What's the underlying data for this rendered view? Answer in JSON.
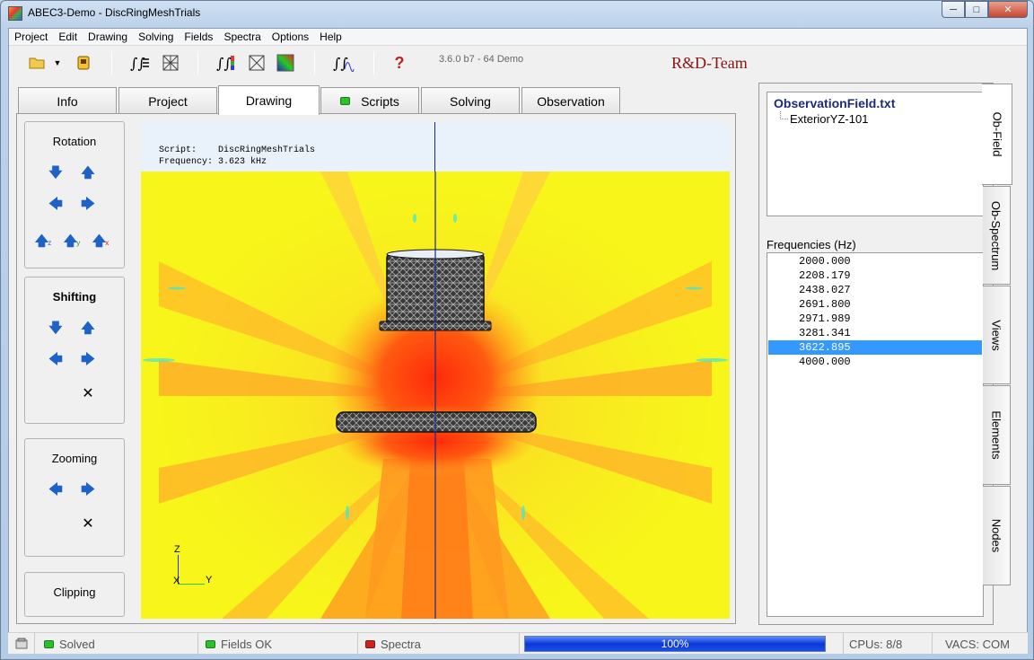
{
  "window": {
    "title": "ABEC3-Demo - DiscRingMeshTrials"
  },
  "menu": [
    "Project",
    "Edit",
    "Drawing",
    "Solving",
    "Fields",
    "Spectra",
    "Options",
    "Help"
  ],
  "toolbar": {
    "version": "3.6.0 b7 - 64 Demo",
    "team": "R&D-Team",
    "help_glyph": "?"
  },
  "tabs": [
    "Info",
    "Project",
    "Drawing",
    "Scripts",
    "Solving",
    "Observation"
  ],
  "active_tab": "Drawing",
  "controls": {
    "rotation": {
      "title": "Rotation",
      "axes": [
        "z",
        "y",
        "x"
      ]
    },
    "shifting": {
      "title": "Shifting"
    },
    "zooming": {
      "title": "Zooming"
    },
    "clipping": {
      "title": "Clipping"
    }
  },
  "viewport": {
    "script_label": "Script:",
    "script_value": "DiscRingMeshTrials",
    "frequency_label": "Frequency:",
    "frequency_value": "3.623 kHz",
    "axis_z": "Z",
    "axis_x": "X",
    "axis_y": "Y"
  },
  "observation": {
    "file": "ObservationField.txt",
    "child": "ExteriorYZ-101",
    "frequencies_label": "Frequencies  (Hz)",
    "frequencies": [
      "2000.000",
      "2208.179",
      "2438.027",
      "2691.800",
      "2971.989",
      "3281.341",
      "3622.895",
      "4000.000"
    ],
    "selected_index": 6
  },
  "vertical_tabs": [
    "Ob-Field",
    "Ob-Spectrum",
    "Views",
    "Elements",
    "Nodes"
  ],
  "status": {
    "solved": "Solved",
    "fields": "Fields OK",
    "spectra": "Spectra",
    "progress": "100%",
    "progress_value": 1.0,
    "cpus": "CPUs: 8/8",
    "vacs": "VACS: COM"
  },
  "colors": {
    "field_low": "#f7f51a",
    "field_mid": "#ffa020",
    "field_high": "#ff3a10",
    "field_cool": "#40e8d8",
    "accent_blue": "#1f62c7",
    "team_red": "#8a1414"
  }
}
